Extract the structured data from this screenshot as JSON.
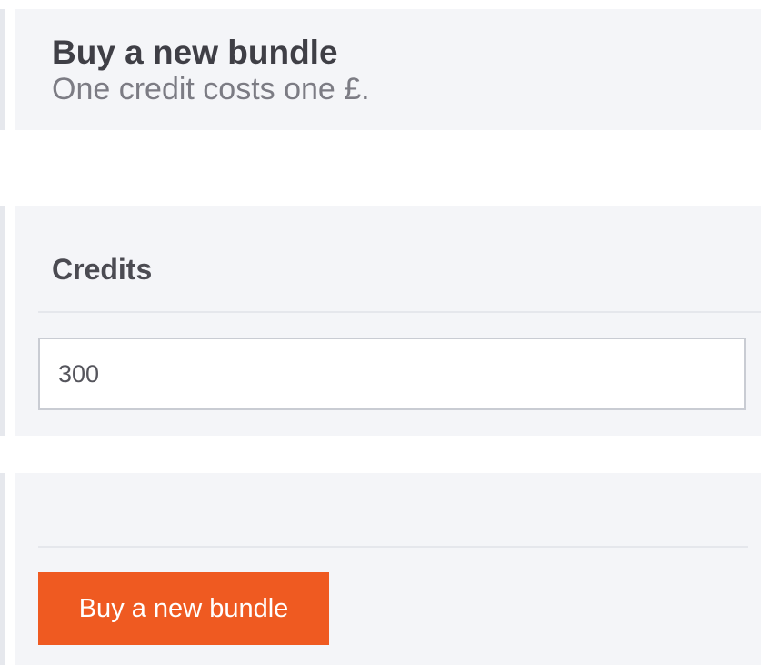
{
  "header": {
    "title": "Buy a new bundle",
    "subtitle": "One credit costs one £."
  },
  "credits": {
    "label": "Credits",
    "value": "300"
  },
  "actions": {
    "buy_label": "Buy a new bundle"
  },
  "colors": {
    "accent": "#ef5a21",
    "panel_bg": "#f4f5f8"
  }
}
